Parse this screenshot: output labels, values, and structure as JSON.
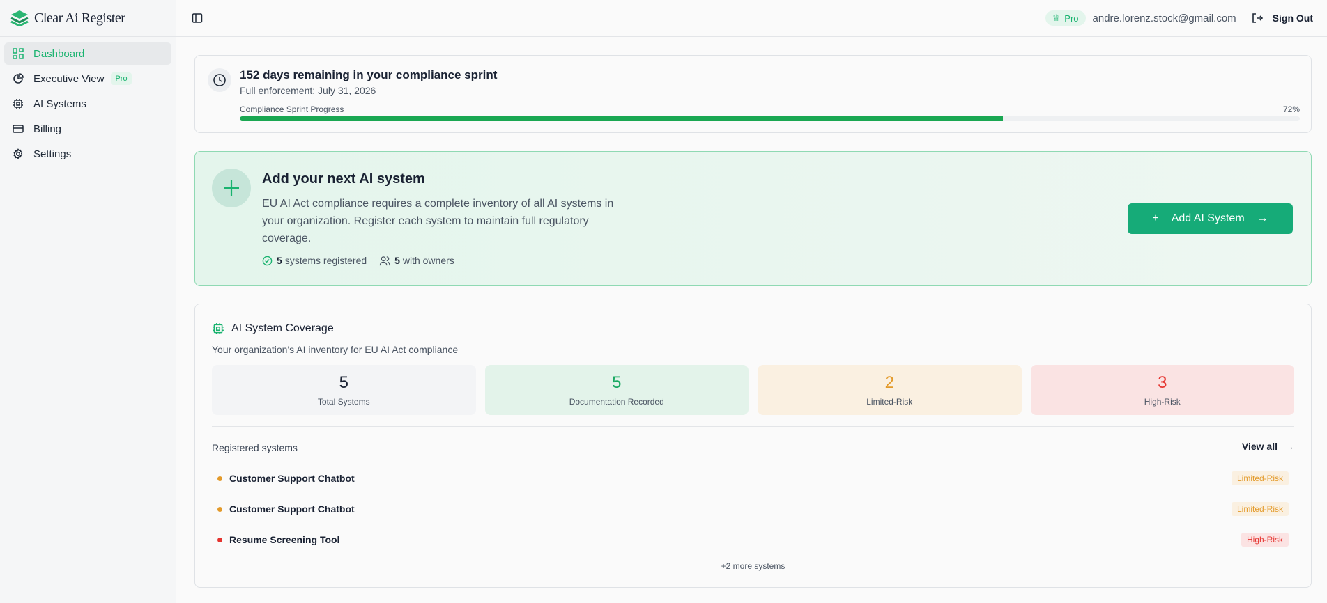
{
  "app": {
    "name": "Clear Ai Register"
  },
  "sidebar": {
    "items": [
      {
        "label": "Dashboard",
        "icon": "dashboard-icon",
        "active": true
      },
      {
        "label": "Executive View",
        "icon": "pie-chart-icon",
        "badge": "Pro"
      },
      {
        "label": "AI Systems",
        "icon": "cpu-icon"
      },
      {
        "label": "Billing",
        "icon": "credit-card-icon"
      },
      {
        "label": "Settings",
        "icon": "gear-icon"
      }
    ]
  },
  "header": {
    "plan": "Pro",
    "email": "andre.lorenz.stock@gmail.com",
    "sign_out": "Sign Out"
  },
  "sprint": {
    "title": "152 days remaining in your compliance sprint",
    "subtitle": "Full enforcement: July 31, 2026",
    "progress_label": "Compliance Sprint Progress",
    "progress_text": "72%",
    "progress": 72
  },
  "add": {
    "title": "Add your next AI system",
    "description": "EU AI Act compliance requires a complete inventory of all AI systems in your organization. Register each system to maintain full regulatory coverage.",
    "registered_count": "5",
    "registered_label": "systems registered",
    "owners_count": "5",
    "owners_label": "with owners",
    "button": "Add AI System"
  },
  "coverage": {
    "title": "AI System Coverage",
    "subtitle": "Your organization's AI inventory for EU AI Act compliance",
    "stats": [
      {
        "value": "5",
        "label": "Total Systems"
      },
      {
        "value": "5",
        "label": "Documentation Recorded"
      },
      {
        "value": "2",
        "label": "Limited-Risk"
      },
      {
        "value": "3",
        "label": "High-Risk"
      }
    ],
    "list_title": "Registered systems",
    "view_all": "View all",
    "systems": [
      {
        "name": "Customer Support Chatbot",
        "risk": "Limited-Risk"
      },
      {
        "name": "Customer Support Chatbot",
        "risk": "Limited-Risk"
      },
      {
        "name": "Resume Screening Tool",
        "risk": "High-Risk"
      }
    ],
    "more": "+2 more systems"
  },
  "colors": {
    "accent": "#19b36f",
    "limited": "#e39a2a",
    "high": "#e5342f"
  }
}
